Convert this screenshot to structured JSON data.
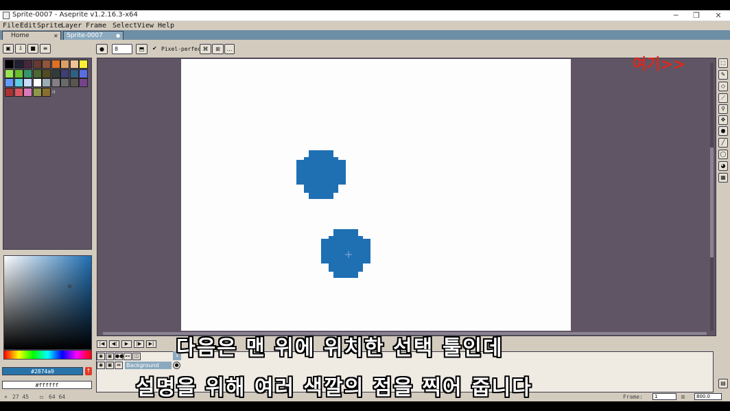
{
  "window": {
    "title": "Sprite-0007 - Aseprite v1.2.16.3-x64",
    "minimize_glyph": "─",
    "restore_glyph": "❐",
    "close_glyph": "✕"
  },
  "menu": [
    "File",
    "Edit",
    "Sprite",
    "Layer",
    "Frame",
    "Select",
    "View",
    "Help"
  ],
  "tabs": [
    {
      "label": "Home",
      "close_glyph": "✕",
      "active": false
    },
    {
      "label": "Sprite-0007",
      "close_glyph": "●",
      "active": true
    }
  ],
  "context_bar": {
    "brush_size": "8",
    "pixel_perfect_label": "Pixel-perfect",
    "pixel_perfect_checked": true
  },
  "palette": {
    "colors": [
      "#000000",
      "#222034",
      "#45283c",
      "#663931",
      "#8f563b",
      "#df7126",
      "#d9a066",
      "#eec39a",
      "#fbf236",
      "#99e550",
      "#6abe30",
      "#37946e",
      "#4b692f",
      "#524b24",
      "#323c39",
      "#3f3f74",
      "#306082",
      "#5b6ee1",
      "#639bff",
      "#5fcde4",
      "#cbdbfc",
      "#ffffff",
      "#9badb7",
      "#847e87",
      "#696a6a",
      "#595652",
      "#76428a",
      "#ac3232",
      "#d95763",
      "#d77bba",
      "#8f974a",
      "#8a6f30"
    ]
  },
  "colors": {
    "foreground_hex": "#2874a9",
    "background_hex": "#ffffff",
    "accent": "#2874a9"
  },
  "timeline": {
    "layer_name": "Background",
    "frame_number": "1"
  },
  "status": {
    "cursor_pos": "27 45",
    "sprite_size": "64 64",
    "frame_label": "Frame:",
    "frame_value": "1",
    "zoom_value": "800.0"
  },
  "overlay": {
    "annotation": "여기>>",
    "subtitle_line1": "다음은 맨 위에 위치한 선택 툴인데",
    "subtitle_line2": "설명을 위해 여러 색깔의 점을 찍어 줍니다"
  },
  "icons": {
    "tools": [
      "marquee-icon",
      "pencil-icon",
      "eraser-icon",
      "eyedropper-icon",
      "zoom-icon",
      "move-icon",
      "fill-icon",
      "line-icon",
      "ellipse-icon",
      "contour-icon",
      "blur-icon"
    ]
  }
}
